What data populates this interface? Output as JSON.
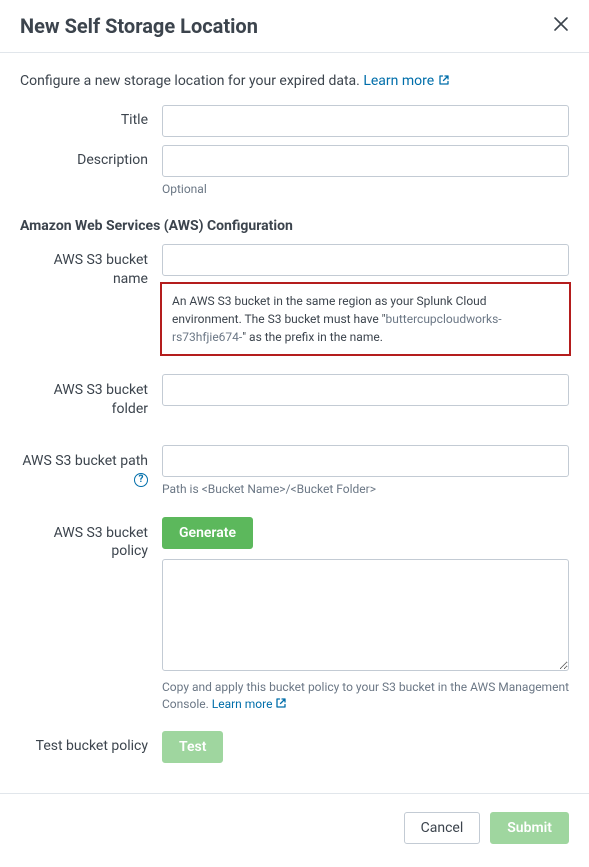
{
  "header": {
    "title": "New Self Storage Location"
  },
  "intro": {
    "text": "Configure a new storage location for your expired data. ",
    "link": "Learn more"
  },
  "fields": {
    "title": {
      "label": "Title",
      "value": ""
    },
    "description": {
      "label": "Description",
      "value": "",
      "hint": "Optional"
    }
  },
  "aws": {
    "section_title": "Amazon Web Services (AWS) Configuration",
    "bucket_name": {
      "label": "AWS S3 bucket name",
      "value": "",
      "callout_a": "An AWS S3 bucket in the same region as your Splunk Cloud environment. The S3 bucket must have \"",
      "callout_prefix": "buttercupcloudworks-rs73hfjie674-",
      "callout_b": "\" as the prefix in the name."
    },
    "bucket_folder": {
      "label": "AWS S3 bucket folder",
      "value": ""
    },
    "bucket_path": {
      "label": "AWS S3 bucket path",
      "value": "",
      "hint": "Path is <Bucket Name>/<Bucket Folder>"
    },
    "bucket_policy": {
      "label": "AWS S3 bucket policy",
      "generate": "Generate",
      "value": "",
      "hint_a": "Copy and apply this bucket policy to your S3 bucket in the AWS Management Console. ",
      "hint_link": "Learn more"
    },
    "test": {
      "label": "Test bucket policy",
      "button": "Test"
    }
  },
  "footer": {
    "cancel": "Cancel",
    "submit": "Submit"
  }
}
